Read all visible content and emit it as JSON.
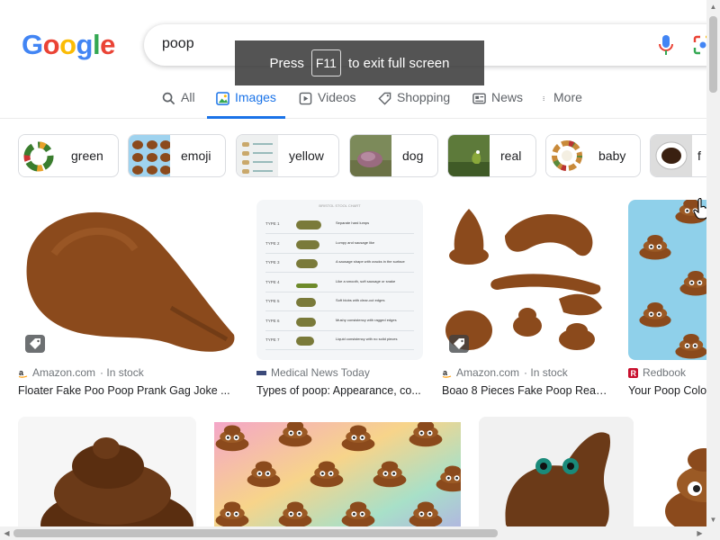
{
  "logo": "Google",
  "search": {
    "query": "poop"
  },
  "fullscreen": {
    "press": "Press",
    "key": "F11",
    "message": "to exit full screen"
  },
  "tabs": [
    {
      "label": "All"
    },
    {
      "label": "Images"
    },
    {
      "label": "Videos"
    },
    {
      "label": "Shopping"
    },
    {
      "label": "News"
    },
    {
      "label": "More"
    }
  ],
  "chips": [
    {
      "label": "green"
    },
    {
      "label": "emoji"
    },
    {
      "label": "yellow"
    },
    {
      "label": "dog"
    },
    {
      "label": "real"
    },
    {
      "label": "baby"
    },
    {
      "label": "f"
    }
  ],
  "results": [
    {
      "source": "Amazon.com",
      "stock": "· In stock",
      "title": "Floater Fake Poo Poop Prank Gag Joke ..."
    },
    {
      "source": "Medical News Today",
      "stock": "",
      "title": "Types of poop: Appearance, co..."
    },
    {
      "source": "Amazon.com",
      "stock": "· In stock",
      "title": "Boao 8 Pieces Fake Poop Reali..."
    },
    {
      "source": "Redbook",
      "stock": "",
      "title": "Your Poop Colo"
    }
  ],
  "stool_chart": {
    "heading": "BRISTOL STOOL CHART",
    "types": [
      "TYPE 1",
      "TYPE 2",
      "TYPE 3",
      "TYPE 4",
      "TYPE 5",
      "TYPE 6",
      "TYPE 7"
    ],
    "descriptions": [
      "Separate hard lumps",
      "Lumpy and sausage like",
      "A sausage shape with cracks in the surface",
      "Like a smooth, soft sausage or snake",
      "Soft blobs with clear-cut edges",
      "Mushy consistency with ragged edges",
      "Liquid consistency with no solid pieces"
    ]
  },
  "colors": {
    "accent": "#1a73e8",
    "poop": "#8b4a1c",
    "poop_dark": "#5a2e10"
  }
}
